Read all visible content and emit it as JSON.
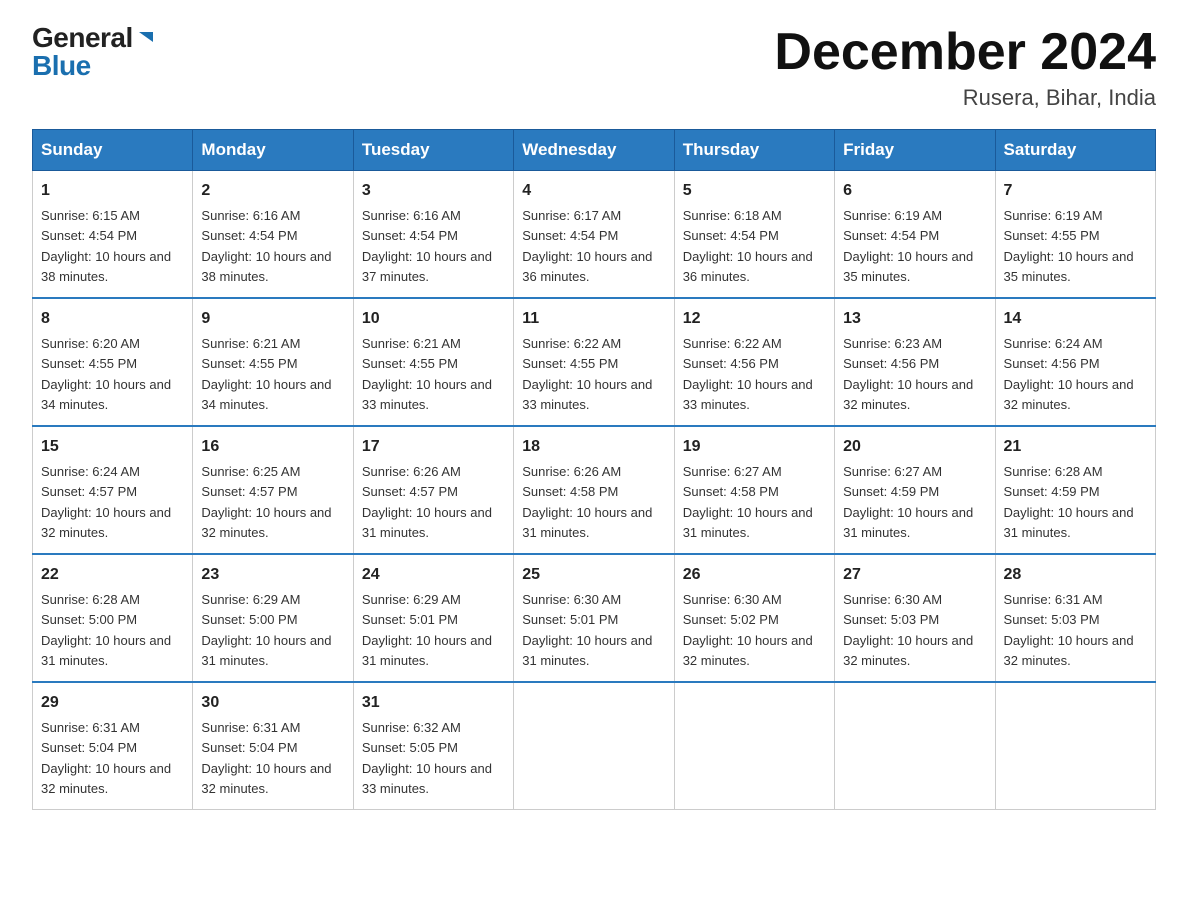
{
  "logo": {
    "general": "General",
    "blue": "Blue"
  },
  "title": "December 2024",
  "subtitle": "Rusera, Bihar, India",
  "headers": [
    "Sunday",
    "Monday",
    "Tuesday",
    "Wednesday",
    "Thursday",
    "Friday",
    "Saturday"
  ],
  "weeks": [
    [
      {
        "day": "1",
        "sunrise": "6:15 AM",
        "sunset": "4:54 PM",
        "daylight": "10 hours and 38 minutes."
      },
      {
        "day": "2",
        "sunrise": "6:16 AM",
        "sunset": "4:54 PM",
        "daylight": "10 hours and 38 minutes."
      },
      {
        "day": "3",
        "sunrise": "6:16 AM",
        "sunset": "4:54 PM",
        "daylight": "10 hours and 37 minutes."
      },
      {
        "day": "4",
        "sunrise": "6:17 AM",
        "sunset": "4:54 PM",
        "daylight": "10 hours and 36 minutes."
      },
      {
        "day": "5",
        "sunrise": "6:18 AM",
        "sunset": "4:54 PM",
        "daylight": "10 hours and 36 minutes."
      },
      {
        "day": "6",
        "sunrise": "6:19 AM",
        "sunset": "4:54 PM",
        "daylight": "10 hours and 35 minutes."
      },
      {
        "day": "7",
        "sunrise": "6:19 AM",
        "sunset": "4:55 PM",
        "daylight": "10 hours and 35 minutes."
      }
    ],
    [
      {
        "day": "8",
        "sunrise": "6:20 AM",
        "sunset": "4:55 PM",
        "daylight": "10 hours and 34 minutes."
      },
      {
        "day": "9",
        "sunrise": "6:21 AM",
        "sunset": "4:55 PM",
        "daylight": "10 hours and 34 minutes."
      },
      {
        "day": "10",
        "sunrise": "6:21 AM",
        "sunset": "4:55 PM",
        "daylight": "10 hours and 33 minutes."
      },
      {
        "day": "11",
        "sunrise": "6:22 AM",
        "sunset": "4:55 PM",
        "daylight": "10 hours and 33 minutes."
      },
      {
        "day": "12",
        "sunrise": "6:22 AM",
        "sunset": "4:56 PM",
        "daylight": "10 hours and 33 minutes."
      },
      {
        "day": "13",
        "sunrise": "6:23 AM",
        "sunset": "4:56 PM",
        "daylight": "10 hours and 32 minutes."
      },
      {
        "day": "14",
        "sunrise": "6:24 AM",
        "sunset": "4:56 PM",
        "daylight": "10 hours and 32 minutes."
      }
    ],
    [
      {
        "day": "15",
        "sunrise": "6:24 AM",
        "sunset": "4:57 PM",
        "daylight": "10 hours and 32 minutes."
      },
      {
        "day": "16",
        "sunrise": "6:25 AM",
        "sunset": "4:57 PM",
        "daylight": "10 hours and 32 minutes."
      },
      {
        "day": "17",
        "sunrise": "6:26 AM",
        "sunset": "4:57 PM",
        "daylight": "10 hours and 31 minutes."
      },
      {
        "day": "18",
        "sunrise": "6:26 AM",
        "sunset": "4:58 PM",
        "daylight": "10 hours and 31 minutes."
      },
      {
        "day": "19",
        "sunrise": "6:27 AM",
        "sunset": "4:58 PM",
        "daylight": "10 hours and 31 minutes."
      },
      {
        "day": "20",
        "sunrise": "6:27 AM",
        "sunset": "4:59 PM",
        "daylight": "10 hours and 31 minutes."
      },
      {
        "day": "21",
        "sunrise": "6:28 AM",
        "sunset": "4:59 PM",
        "daylight": "10 hours and 31 minutes."
      }
    ],
    [
      {
        "day": "22",
        "sunrise": "6:28 AM",
        "sunset": "5:00 PM",
        "daylight": "10 hours and 31 minutes."
      },
      {
        "day": "23",
        "sunrise": "6:29 AM",
        "sunset": "5:00 PM",
        "daylight": "10 hours and 31 minutes."
      },
      {
        "day": "24",
        "sunrise": "6:29 AM",
        "sunset": "5:01 PM",
        "daylight": "10 hours and 31 minutes."
      },
      {
        "day": "25",
        "sunrise": "6:30 AM",
        "sunset": "5:01 PM",
        "daylight": "10 hours and 31 minutes."
      },
      {
        "day": "26",
        "sunrise": "6:30 AM",
        "sunset": "5:02 PM",
        "daylight": "10 hours and 32 minutes."
      },
      {
        "day": "27",
        "sunrise": "6:30 AM",
        "sunset": "5:03 PM",
        "daylight": "10 hours and 32 minutes."
      },
      {
        "day": "28",
        "sunrise": "6:31 AM",
        "sunset": "5:03 PM",
        "daylight": "10 hours and 32 minutes."
      }
    ],
    [
      {
        "day": "29",
        "sunrise": "6:31 AM",
        "sunset": "5:04 PM",
        "daylight": "10 hours and 32 minutes."
      },
      {
        "day": "30",
        "sunrise": "6:31 AM",
        "sunset": "5:04 PM",
        "daylight": "10 hours and 32 minutes."
      },
      {
        "day": "31",
        "sunrise": "6:32 AM",
        "sunset": "5:05 PM",
        "daylight": "10 hours and 33 minutes."
      },
      null,
      null,
      null,
      null
    ]
  ]
}
